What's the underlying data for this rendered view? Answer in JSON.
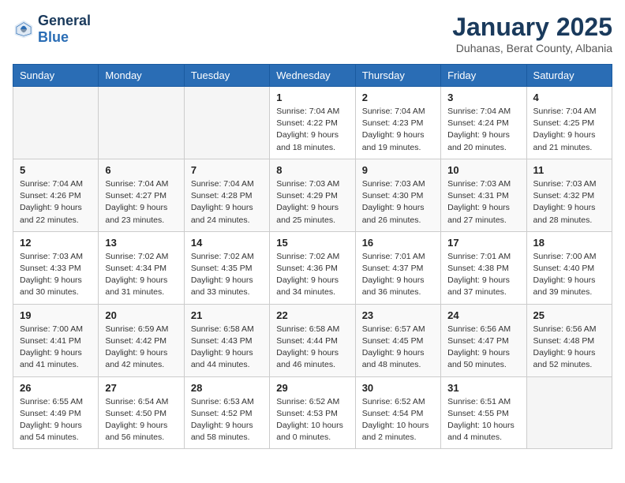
{
  "header": {
    "logo": {
      "general": "General",
      "blue": "Blue"
    },
    "title": "January 2025",
    "subtitle": "Duhanas, Berat County, Albania"
  },
  "weekdays": [
    "Sunday",
    "Monday",
    "Tuesday",
    "Wednesday",
    "Thursday",
    "Friday",
    "Saturday"
  ],
  "weeks": [
    [
      {
        "day": "",
        "sunrise": "",
        "sunset": "",
        "daylight": ""
      },
      {
        "day": "",
        "sunrise": "",
        "sunset": "",
        "daylight": ""
      },
      {
        "day": "",
        "sunrise": "",
        "sunset": "",
        "daylight": ""
      },
      {
        "day": "1",
        "sunrise": "Sunrise: 7:04 AM",
        "sunset": "Sunset: 4:22 PM",
        "daylight": "Daylight: 9 hours and 18 minutes."
      },
      {
        "day": "2",
        "sunrise": "Sunrise: 7:04 AM",
        "sunset": "Sunset: 4:23 PM",
        "daylight": "Daylight: 9 hours and 19 minutes."
      },
      {
        "day": "3",
        "sunrise": "Sunrise: 7:04 AM",
        "sunset": "Sunset: 4:24 PM",
        "daylight": "Daylight: 9 hours and 20 minutes."
      },
      {
        "day": "4",
        "sunrise": "Sunrise: 7:04 AM",
        "sunset": "Sunset: 4:25 PM",
        "daylight": "Daylight: 9 hours and 21 minutes."
      }
    ],
    [
      {
        "day": "5",
        "sunrise": "Sunrise: 7:04 AM",
        "sunset": "Sunset: 4:26 PM",
        "daylight": "Daylight: 9 hours and 22 minutes."
      },
      {
        "day": "6",
        "sunrise": "Sunrise: 7:04 AM",
        "sunset": "Sunset: 4:27 PM",
        "daylight": "Daylight: 9 hours and 23 minutes."
      },
      {
        "day": "7",
        "sunrise": "Sunrise: 7:04 AM",
        "sunset": "Sunset: 4:28 PM",
        "daylight": "Daylight: 9 hours and 24 minutes."
      },
      {
        "day": "8",
        "sunrise": "Sunrise: 7:03 AM",
        "sunset": "Sunset: 4:29 PM",
        "daylight": "Daylight: 9 hours and 25 minutes."
      },
      {
        "day": "9",
        "sunrise": "Sunrise: 7:03 AM",
        "sunset": "Sunset: 4:30 PM",
        "daylight": "Daylight: 9 hours and 26 minutes."
      },
      {
        "day": "10",
        "sunrise": "Sunrise: 7:03 AM",
        "sunset": "Sunset: 4:31 PM",
        "daylight": "Daylight: 9 hours and 27 minutes."
      },
      {
        "day": "11",
        "sunrise": "Sunrise: 7:03 AM",
        "sunset": "Sunset: 4:32 PM",
        "daylight": "Daylight: 9 hours and 28 minutes."
      }
    ],
    [
      {
        "day": "12",
        "sunrise": "Sunrise: 7:03 AM",
        "sunset": "Sunset: 4:33 PM",
        "daylight": "Daylight: 9 hours and 30 minutes."
      },
      {
        "day": "13",
        "sunrise": "Sunrise: 7:02 AM",
        "sunset": "Sunset: 4:34 PM",
        "daylight": "Daylight: 9 hours and 31 minutes."
      },
      {
        "day": "14",
        "sunrise": "Sunrise: 7:02 AM",
        "sunset": "Sunset: 4:35 PM",
        "daylight": "Daylight: 9 hours and 33 minutes."
      },
      {
        "day": "15",
        "sunrise": "Sunrise: 7:02 AM",
        "sunset": "Sunset: 4:36 PM",
        "daylight": "Daylight: 9 hours and 34 minutes."
      },
      {
        "day": "16",
        "sunrise": "Sunrise: 7:01 AM",
        "sunset": "Sunset: 4:37 PM",
        "daylight": "Daylight: 9 hours and 36 minutes."
      },
      {
        "day": "17",
        "sunrise": "Sunrise: 7:01 AM",
        "sunset": "Sunset: 4:38 PM",
        "daylight": "Daylight: 9 hours and 37 minutes."
      },
      {
        "day": "18",
        "sunrise": "Sunrise: 7:00 AM",
        "sunset": "Sunset: 4:40 PM",
        "daylight": "Daylight: 9 hours and 39 minutes."
      }
    ],
    [
      {
        "day": "19",
        "sunrise": "Sunrise: 7:00 AM",
        "sunset": "Sunset: 4:41 PM",
        "daylight": "Daylight: 9 hours and 41 minutes."
      },
      {
        "day": "20",
        "sunrise": "Sunrise: 6:59 AM",
        "sunset": "Sunset: 4:42 PM",
        "daylight": "Daylight: 9 hours and 42 minutes."
      },
      {
        "day": "21",
        "sunrise": "Sunrise: 6:58 AM",
        "sunset": "Sunset: 4:43 PM",
        "daylight": "Daylight: 9 hours and 44 minutes."
      },
      {
        "day": "22",
        "sunrise": "Sunrise: 6:58 AM",
        "sunset": "Sunset: 4:44 PM",
        "daylight": "Daylight: 9 hours and 46 minutes."
      },
      {
        "day": "23",
        "sunrise": "Sunrise: 6:57 AM",
        "sunset": "Sunset: 4:45 PM",
        "daylight": "Daylight: 9 hours and 48 minutes."
      },
      {
        "day": "24",
        "sunrise": "Sunrise: 6:56 AM",
        "sunset": "Sunset: 4:47 PM",
        "daylight": "Daylight: 9 hours and 50 minutes."
      },
      {
        "day": "25",
        "sunrise": "Sunrise: 6:56 AM",
        "sunset": "Sunset: 4:48 PM",
        "daylight": "Daylight: 9 hours and 52 minutes."
      }
    ],
    [
      {
        "day": "26",
        "sunrise": "Sunrise: 6:55 AM",
        "sunset": "Sunset: 4:49 PM",
        "daylight": "Daylight: 9 hours and 54 minutes."
      },
      {
        "day": "27",
        "sunrise": "Sunrise: 6:54 AM",
        "sunset": "Sunset: 4:50 PM",
        "daylight": "Daylight: 9 hours and 56 minutes."
      },
      {
        "day": "28",
        "sunrise": "Sunrise: 6:53 AM",
        "sunset": "Sunset: 4:52 PM",
        "daylight": "Daylight: 9 hours and 58 minutes."
      },
      {
        "day": "29",
        "sunrise": "Sunrise: 6:52 AM",
        "sunset": "Sunset: 4:53 PM",
        "daylight": "Daylight: 10 hours and 0 minutes."
      },
      {
        "day": "30",
        "sunrise": "Sunrise: 6:52 AM",
        "sunset": "Sunset: 4:54 PM",
        "daylight": "Daylight: 10 hours and 2 minutes."
      },
      {
        "day": "31",
        "sunrise": "Sunrise: 6:51 AM",
        "sunset": "Sunset: 4:55 PM",
        "daylight": "Daylight: 10 hours and 4 minutes."
      },
      {
        "day": "",
        "sunrise": "",
        "sunset": "",
        "daylight": ""
      }
    ]
  ]
}
